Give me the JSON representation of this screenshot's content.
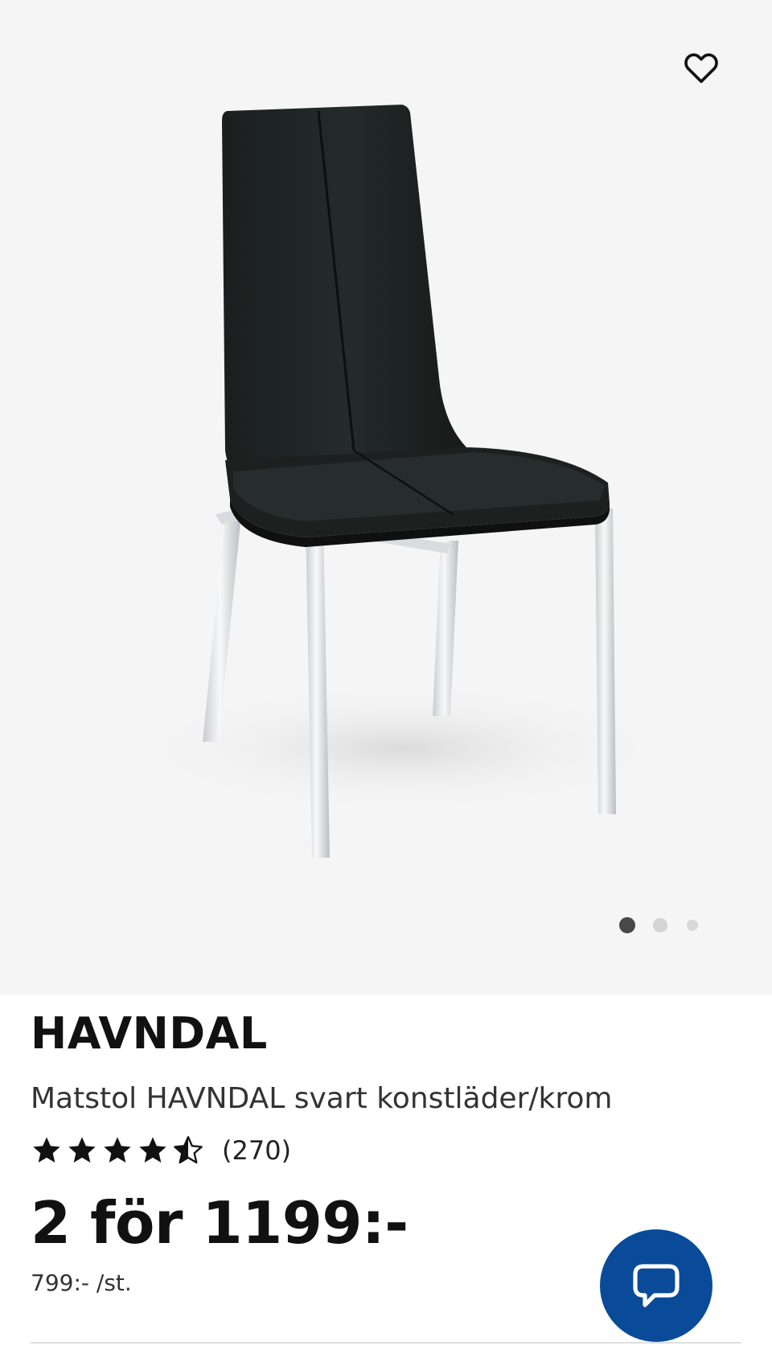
{
  "product": {
    "brand": "HAVNDAL",
    "description": "Matstol HAVNDAL svart konstläder/krom",
    "rating": 4.5,
    "rating_max": 5,
    "review_count": "(270)",
    "price": "2 för 1199:-",
    "unit_price": "799:- /st."
  },
  "gallery": {
    "image_count": 3,
    "active_index": 1
  },
  "icons": {
    "favorite": "heart-outline-icon",
    "chat": "chat-bubble-icon"
  },
  "colors": {
    "gallery_bg": "#f5f5f5",
    "chat_button": "#0a4b99",
    "text": "#111111"
  }
}
